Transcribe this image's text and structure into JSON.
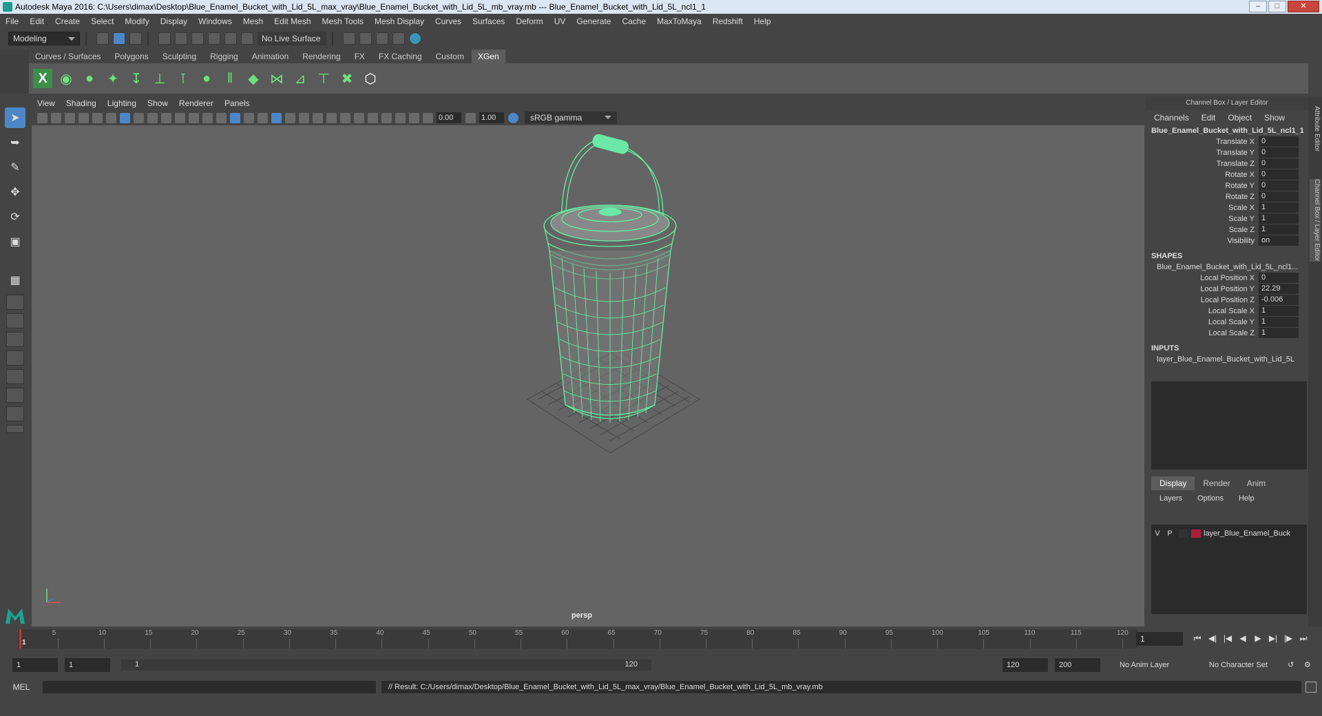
{
  "window": {
    "title": "Autodesk Maya 2016: C:\\Users\\dimax\\Desktop\\Blue_Enamel_Bucket_with_Lid_5L_max_vray\\Blue_Enamel_Bucket_with_Lid_5L_mb_vray.mb   ---   Blue_Enamel_Bucket_with_Lid_5L_ncl1_1"
  },
  "menu": [
    "File",
    "Edit",
    "Create",
    "Select",
    "Modify",
    "Display",
    "Windows",
    "Mesh",
    "Edit Mesh",
    "Mesh Tools",
    "Mesh Display",
    "Curves",
    "Surfaces",
    "Deform",
    "UV",
    "Generate",
    "Cache",
    "MaxToMaya",
    "Redshift",
    "Help"
  ],
  "status": {
    "mode": "Modeling",
    "live_surface": "No Live Surface"
  },
  "shelf_tabs": [
    "Curves / Surfaces",
    "Polygons",
    "Sculpting",
    "Rigging",
    "Animation",
    "Rendering",
    "FX",
    "FX Caching",
    "Custom",
    "XGen"
  ],
  "shelf_active": "XGen",
  "viewport": {
    "menu": [
      "View",
      "Shading",
      "Lighting",
      "Show",
      "Renderer",
      "Panels"
    ],
    "exposure": "0.00",
    "gamma_value": "1.00",
    "color_space": "sRGB gamma",
    "camera": "persp"
  },
  "channel_box": {
    "title": "Channel Box / Layer Editor",
    "menu": [
      "Channels",
      "Edit",
      "Object",
      "Show"
    ],
    "object": "Blue_Enamel_Bucket_with_Lid_5L_ncl1_1",
    "channels": [
      {
        "k": "Translate X",
        "v": "0"
      },
      {
        "k": "Translate Y",
        "v": "0"
      },
      {
        "k": "Translate Z",
        "v": "0"
      },
      {
        "k": "Rotate X",
        "v": "0"
      },
      {
        "k": "Rotate Y",
        "v": "0"
      },
      {
        "k": "Rotate Z",
        "v": "0"
      },
      {
        "k": "Scale X",
        "v": "1"
      },
      {
        "k": "Scale Y",
        "v": "1"
      },
      {
        "k": "Scale Z",
        "v": "1"
      },
      {
        "k": "Visibility",
        "v": "on"
      }
    ],
    "shapes_label": "SHAPES",
    "shape_name": "Blue_Enamel_Bucket_with_Lid_5L_ncl1...",
    "shape_channels": [
      {
        "k": "Local Position X",
        "v": "0"
      },
      {
        "k": "Local Position Y",
        "v": "22.29"
      },
      {
        "k": "Local Position Z",
        "v": "-0.006"
      },
      {
        "k": "Local Scale X",
        "v": "1"
      },
      {
        "k": "Local Scale Y",
        "v": "1"
      },
      {
        "k": "Local Scale Z",
        "v": "1"
      }
    ],
    "inputs_label": "INPUTS",
    "input_name": "layer_Blue_Enamel_Bucket_with_Lid_5L"
  },
  "layer_editor": {
    "tabs": [
      "Display",
      "Render",
      "Anim"
    ],
    "menu": [
      "Layers",
      "Options",
      "Help"
    ],
    "layer": {
      "v": "V",
      "p": "P",
      "name": "layer_Blue_Enamel_Buck",
      "color": "#b01c3e"
    }
  },
  "side_tabs": [
    "Attribute Editor",
    "Channel Box / Layer Editor"
  ],
  "timeline": {
    "ticks": [
      "1",
      "5",
      "10",
      "15",
      "20",
      "25",
      "30",
      "35",
      "40",
      "45",
      "50",
      "55",
      "60",
      "65",
      "70",
      "75",
      "80",
      "85",
      "90",
      "95",
      "100",
      "105",
      "110",
      "115",
      "120"
    ],
    "current_frame": "1"
  },
  "range": {
    "start": "1",
    "playback_start": "1",
    "slider_start": "1",
    "slider_end": "120",
    "playback_end": "120",
    "end": "200",
    "anim_layer": "No Anim Layer",
    "character_set": "No Character Set"
  },
  "command": {
    "lang": "MEL",
    "result": "// Result: C:/Users/dimax/Desktop/Blue_Enamel_Bucket_with_Lid_5L_max_vray/Blue_Enamel_Bucket_with_Lid_5L_mb_vray.mb"
  }
}
